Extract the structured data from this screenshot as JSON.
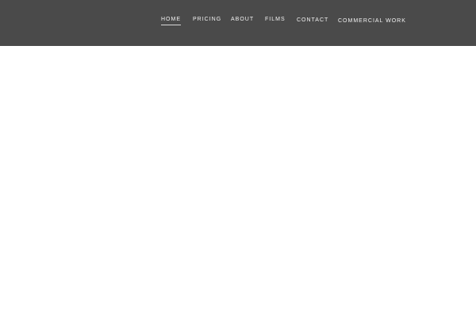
{
  "header": {
    "nav": [
      {
        "label": "HOME",
        "active": true
      },
      {
        "label": "PRICING",
        "active": false
      },
      {
        "label": "ABOUT",
        "active": false
      },
      {
        "label": "FILMS",
        "active": false
      },
      {
        "label": "CONTACT",
        "active": false
      },
      {
        "label": "COMMERCIAL WORK",
        "active": false
      }
    ]
  },
  "colors": {
    "header_bg": "#4a4a4a",
    "nav_text": "#f2f2f2",
    "page_bg": "#ffffff"
  }
}
